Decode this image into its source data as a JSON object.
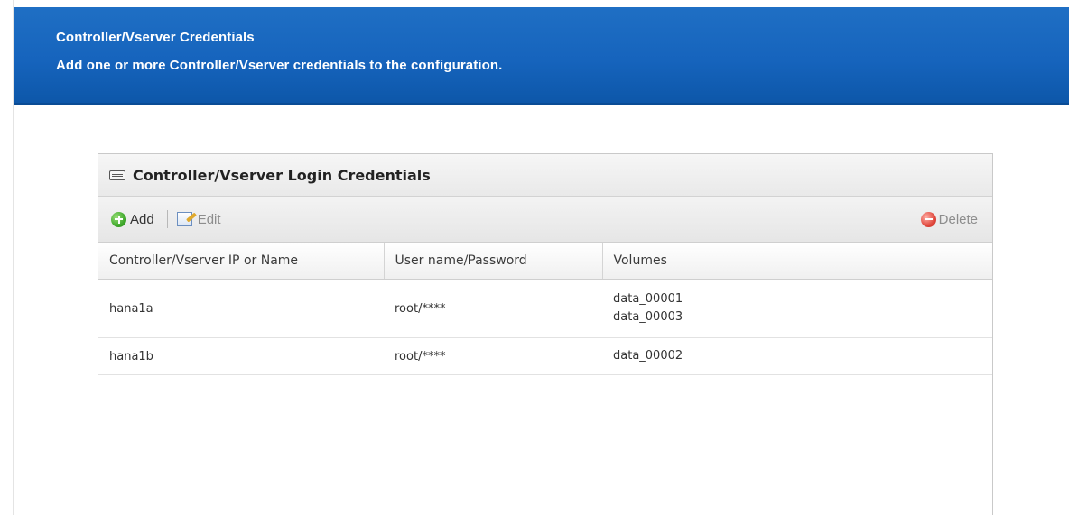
{
  "banner": {
    "title": "Controller/Vserver Credentials",
    "subtitle": "Add one or more Controller/Vserver credentials to the configuration."
  },
  "panel": {
    "title": "Controller/Vserver Login Credentials",
    "icon": "keyboard-icon"
  },
  "toolbar": {
    "add_label": "Add",
    "edit_label": "Edit",
    "delete_label": "Delete"
  },
  "table": {
    "columns": [
      "Controller/Vserver IP or Name",
      "User name/Password",
      "Volumes"
    ],
    "rows": [
      {
        "name": "hana1a",
        "credentials": "root/****",
        "volumes": [
          "data_00001",
          "data_00003"
        ]
      },
      {
        "name": "hana1b",
        "credentials": "root/****",
        "volumes": [
          "data_00002"
        ]
      }
    ]
  },
  "colors": {
    "banner": "#1664bd",
    "add_icon": "#3fa82b",
    "delete_icon": "#e0473c"
  }
}
